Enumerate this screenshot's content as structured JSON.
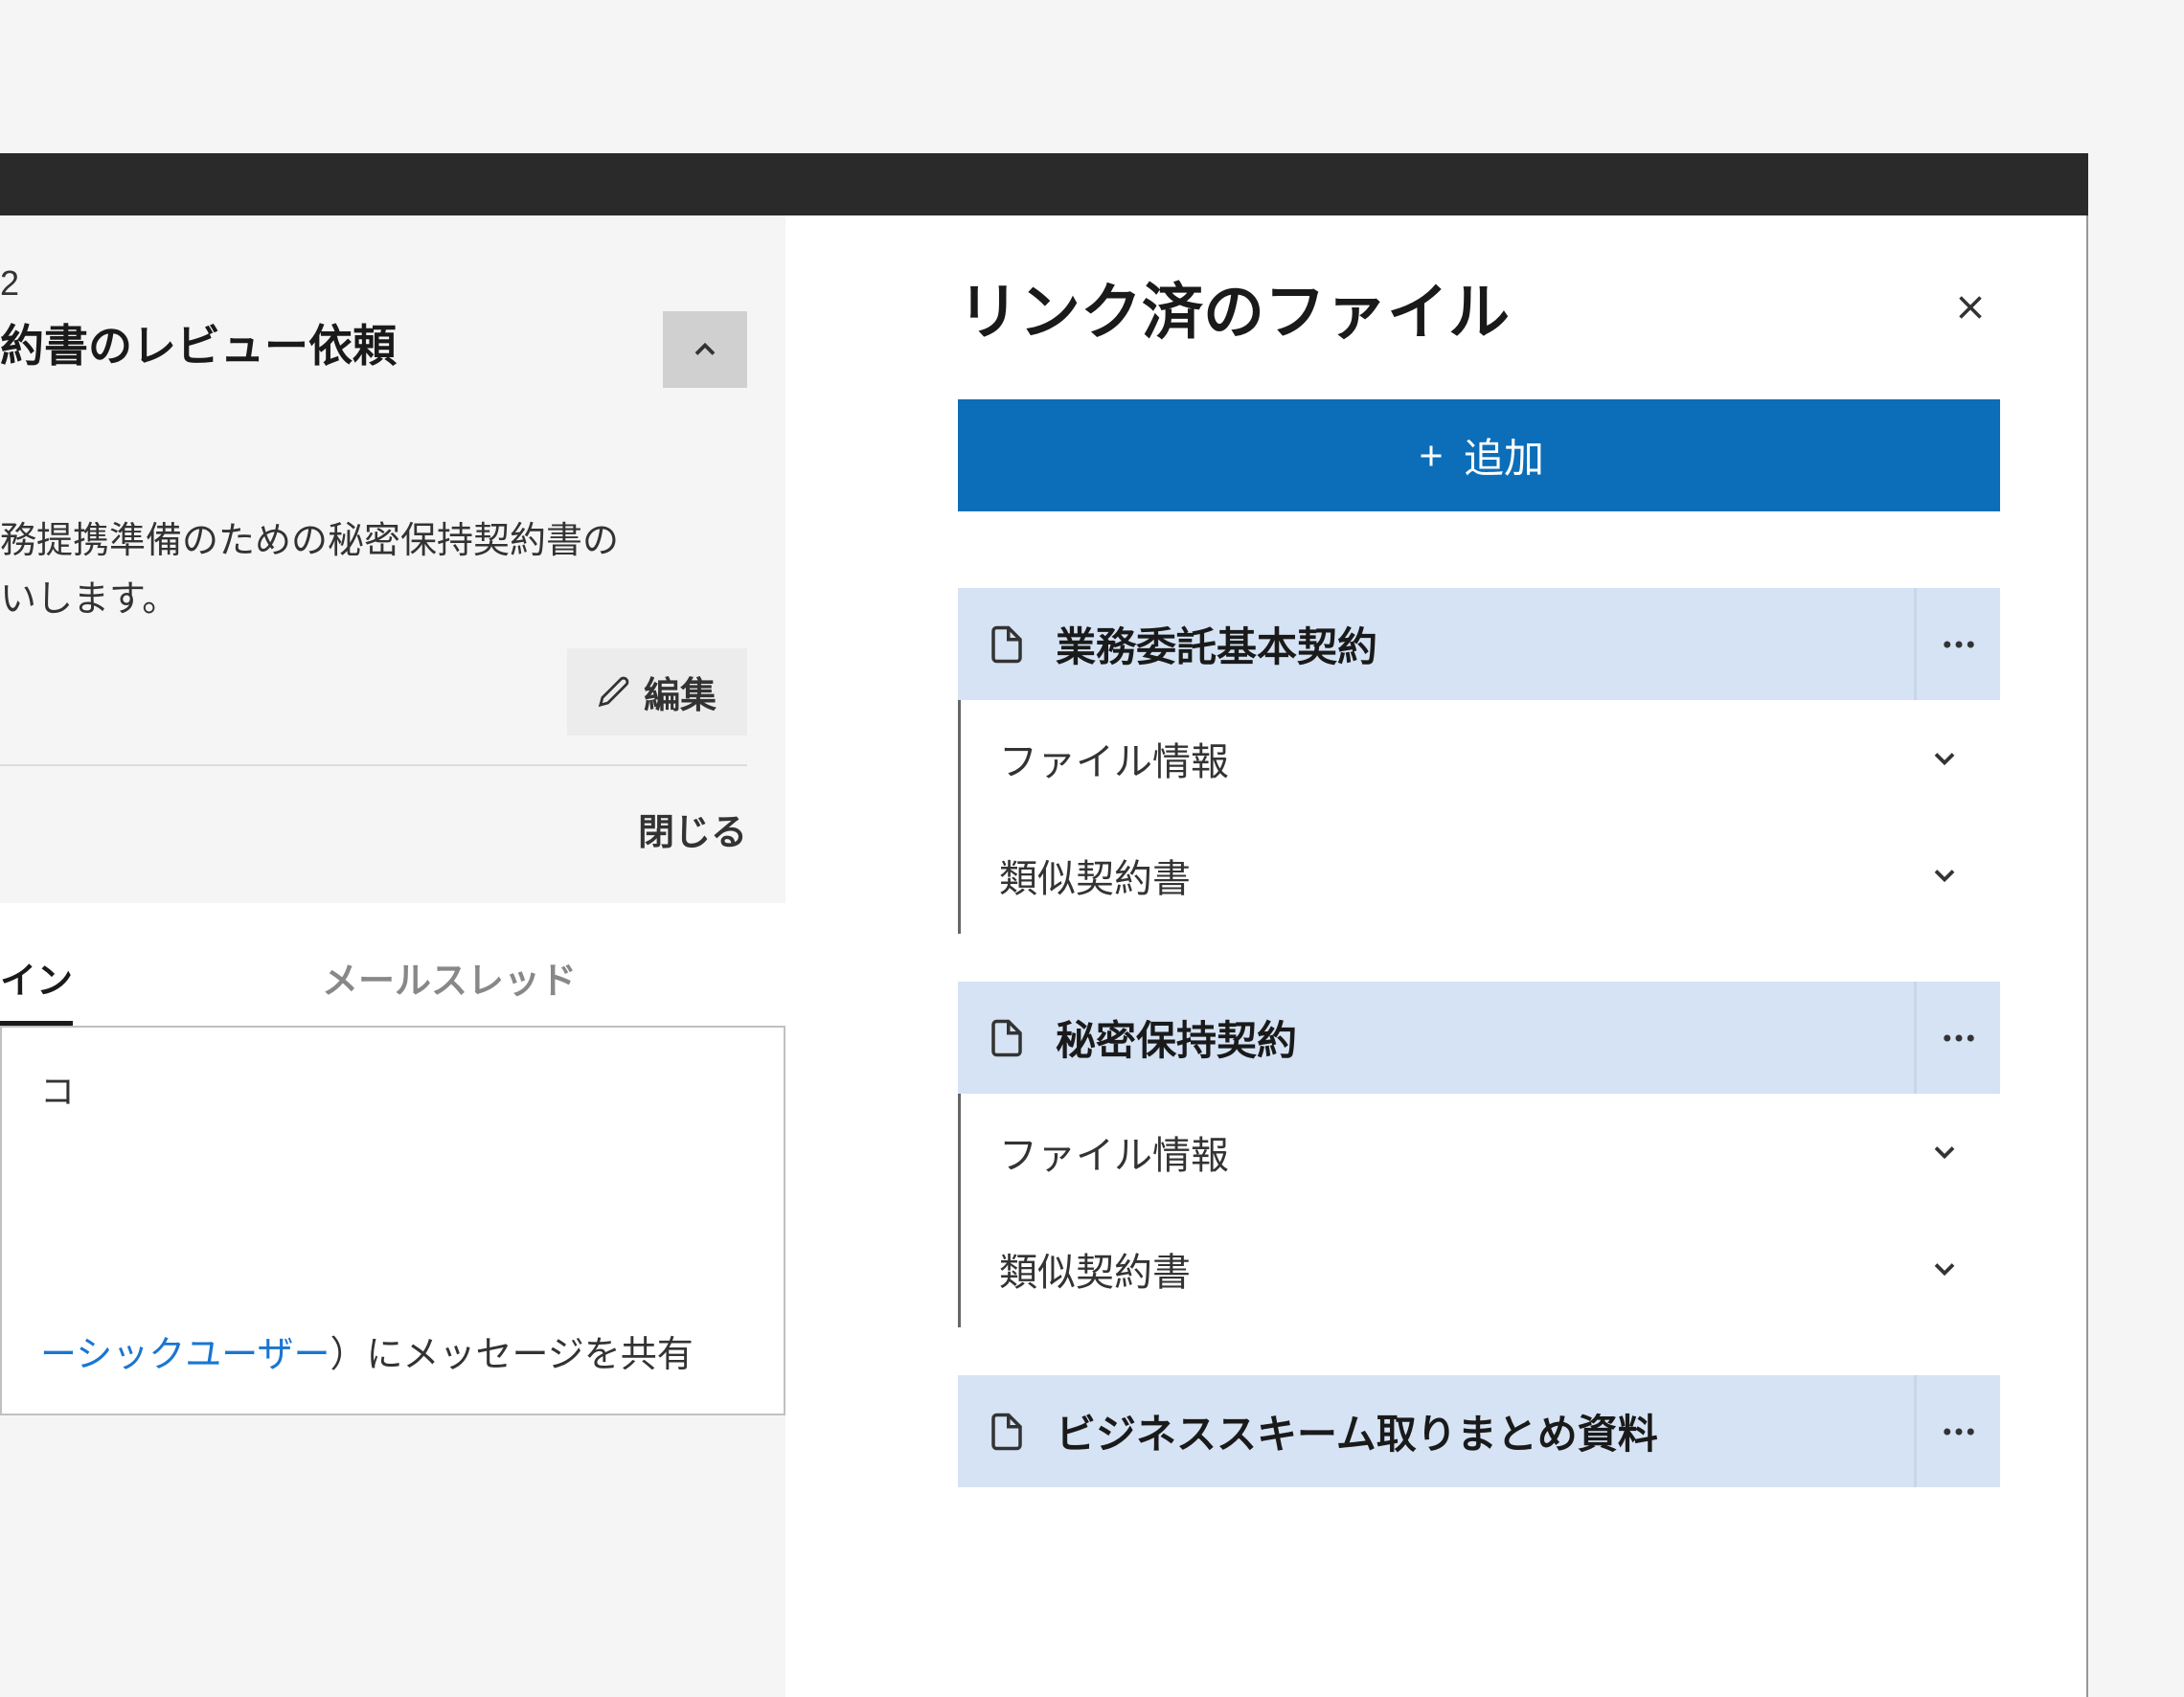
{
  "left_panel": {
    "card_number": "2",
    "card_title": "約書のレビュー依頼",
    "description_line1": "務提携準備のための秘密保持契約書の",
    "description_line2": "いします。",
    "edit_label": "編集",
    "close_label": "閉じる",
    "tabs": {
      "active": "イン",
      "inactive": "メールスレッド"
    },
    "content_placeholder": "コ",
    "message_link": "ーシックユーザー",
    "message_suffix_paren": "）",
    "message_suffix": "にメッセージを共有"
  },
  "right_panel": {
    "title": "リンク済のファイル",
    "add_label": "追加",
    "files": [
      {
        "name": "業務委託基本契約",
        "sections": [
          "ファイル情報",
          "類似契約書"
        ]
      },
      {
        "name": "秘密保持契約",
        "sections": [
          "ファイル情報",
          "類似契約書"
        ]
      },
      {
        "name": "ビジネススキーム取りまとめ資料",
        "sections": []
      }
    ]
  }
}
